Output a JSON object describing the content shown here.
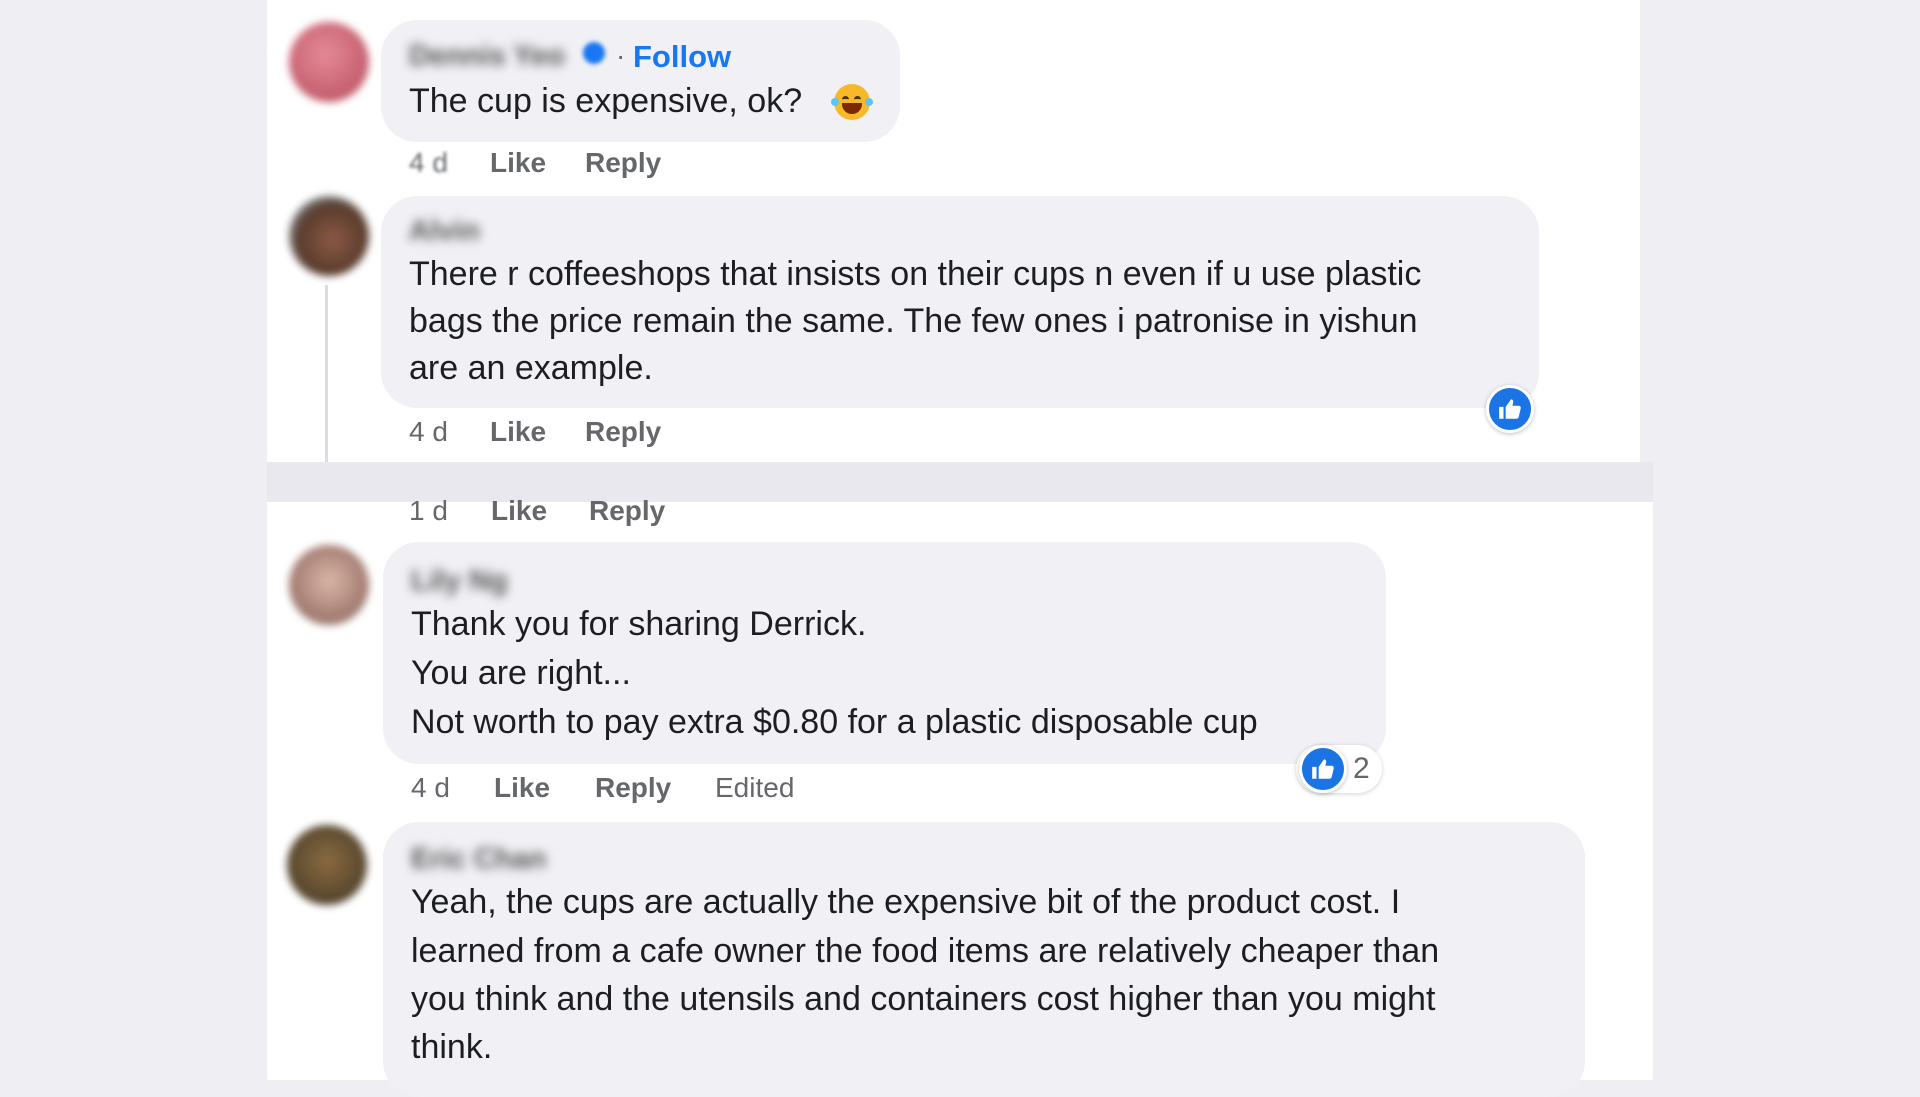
{
  "comments": [
    {
      "author": "Dennis Yeo",
      "follow_label": "Follow",
      "separator": "·",
      "text_lines": [
        "The cup is expensive, ok?"
      ],
      "emoji": "laughing-tears-emoji",
      "time": "4 d",
      "like_label": "Like",
      "reply_label": "Reply"
    },
    {
      "author": "Alvin",
      "text_lines": [
        "There r coffeeshops that insists on their cups n even if u use plastic",
        "bags the price remain the same. The few ones i patronise in yishun",
        "are an example."
      ],
      "time": "4 d",
      "like_label": "Like",
      "reply_label": "Reply",
      "reaction": "like"
    },
    {
      "author": "Lily Ng",
      "text_lines": [
        "Thank you for sharing Derrick.",
        "You are right...",
        "Not worth to pay extra $0.80 for a plastic disposable cup"
      ],
      "time": "4 d",
      "like_label": "Like",
      "reply_label": "Reply",
      "edited_label": "Edited",
      "reaction": "like",
      "reaction_count": "2"
    },
    {
      "author": "Eric Chan",
      "text_lines": [
        "Yeah, the cups are actually the expensive bit of the product cost. I",
        "learned from a cafe owner the food items are relatively cheaper than",
        "you think and the utensils and containers cost higher than you might",
        "think."
      ]
    }
  ],
  "partial_action_row": {
    "time": "1 d",
    "like_label": "Like",
    "reply_label": "Reply"
  },
  "colors": {
    "accent": "#1877f2",
    "bubble": "#f0f0f5",
    "meta": "#65676b",
    "background": "#efeef3"
  }
}
